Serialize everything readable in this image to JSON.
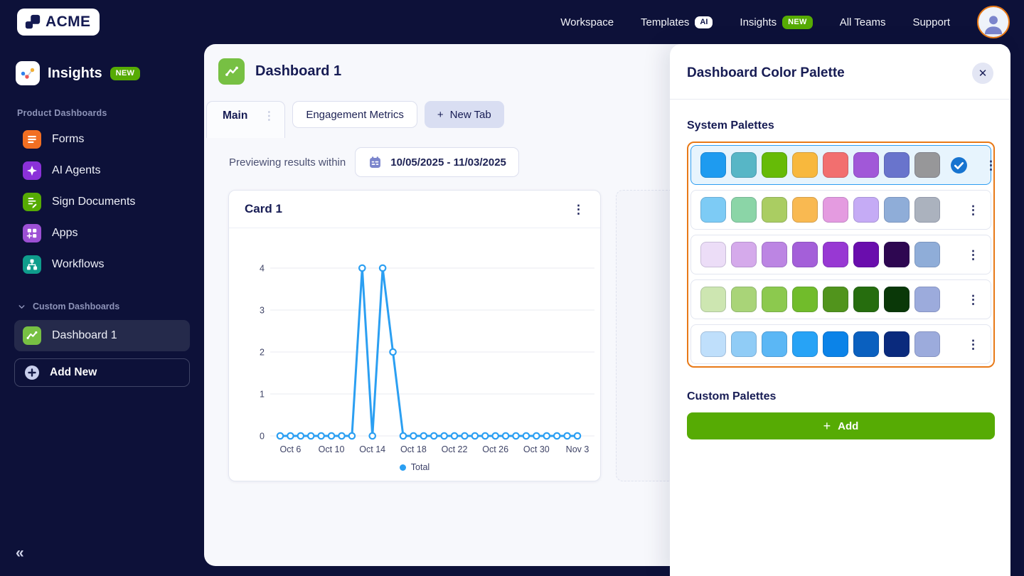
{
  "topnav": {
    "logo": "ACME",
    "items": [
      {
        "label": "Workspace"
      },
      {
        "label": "Templates",
        "badge": "AI",
        "badge_style": "ai"
      },
      {
        "label": "Insights",
        "badge": "NEW",
        "badge_style": "new"
      },
      {
        "label": "All Teams"
      },
      {
        "label": "Support"
      }
    ]
  },
  "sidebar": {
    "app": {
      "title": "Insights",
      "badge": "NEW"
    },
    "product_section_label": "Product Dashboards",
    "product_items": [
      {
        "label": "Forms",
        "icon": "forms-icon",
        "icon_color": "#f26f22"
      },
      {
        "label": "AI Agents",
        "icon": "ai-agents-icon",
        "icon_color": "#8b31d9"
      },
      {
        "label": "Sign Documents",
        "icon": "sign-documents-icon",
        "icon_color": "#56ab04"
      },
      {
        "label": "Apps",
        "icon": "apps-icon",
        "icon_color": "#9c50d4"
      },
      {
        "label": "Workflows",
        "icon": "workflows-icon",
        "icon_color": "#0f9d8c"
      }
    ],
    "custom_section_label": "Custom Dashboards",
    "custom_items": [
      {
        "label": "Dashboard 1",
        "icon": "dashboard-icon",
        "icon_color": "#77c043",
        "active": true
      }
    ],
    "add_new": "Add New",
    "collapse": "«"
  },
  "main": {
    "title": "Dashboard 1",
    "tabs": [
      {
        "label": "Main",
        "active": true
      },
      {
        "label": "Engagement Metrics",
        "active": false
      }
    ],
    "new_tab": "New Tab",
    "preview_label": "Previewing results within",
    "date_range": "10/05/2025 - 11/03/2025",
    "card_title": "Card 1"
  },
  "chart_data": {
    "type": "line",
    "title": "Card 1",
    "x": [
      "Oct 5",
      "Oct 6",
      "Oct 7",
      "Oct 8",
      "Oct 9",
      "Oct 10",
      "Oct 11",
      "Oct 12",
      "Oct 13",
      "Oct 14",
      "Oct 15",
      "Oct 16",
      "Oct 17",
      "Oct 18",
      "Oct 19",
      "Oct 20",
      "Oct 21",
      "Oct 22",
      "Oct 23",
      "Oct 24",
      "Oct 25",
      "Oct 26",
      "Oct 27",
      "Oct 28",
      "Oct 29",
      "Oct 30",
      "Oct 31",
      "Nov 1",
      "Nov 2",
      "Nov 3"
    ],
    "x_tick_labels": [
      "Oct 6",
      "Oct 10",
      "Oct 14",
      "Oct 18",
      "Oct 22",
      "Oct 26",
      "Oct 30",
      "Nov 3"
    ],
    "series": [
      {
        "name": "Total",
        "color": "#2b9ff2",
        "values": [
          0,
          0,
          0,
          0,
          0,
          0,
          0,
          0,
          4,
          0,
          4,
          2,
          0,
          0,
          0,
          0,
          0,
          0,
          0,
          0,
          0,
          0,
          0,
          0,
          0,
          0,
          0,
          0,
          0,
          0
        ]
      }
    ],
    "ylim": [
      0,
      4
    ],
    "yticks": [
      0,
      1,
      2,
      3,
      4
    ],
    "grid": true,
    "legend_position": "bottom"
  },
  "panel": {
    "title": "Dashboard Color Palette",
    "system_heading": "System Palettes",
    "custom_heading": "Custom Palettes",
    "add_button": "Add",
    "accent_border": "#e87917",
    "selected_bg": "#e7f4fd",
    "selected_border": "#2e9df1",
    "add_button_color": "#56ab04",
    "system_palettes": [
      {
        "selected": true,
        "colors": [
          "#1e9bf0",
          "#57b6c6",
          "#66bb07",
          "#f8b83d",
          "#f26f6f",
          "#a158d8",
          "#6974cc",
          "#979799"
        ]
      },
      {
        "selected": false,
        "colors": [
          "#7dcbf5",
          "#8bd5a7",
          "#aacd62",
          "#f9b951",
          "#e49be0",
          "#c5abf5",
          "#8fadd8",
          "#abb2be"
        ]
      },
      {
        "selected": false,
        "colors": [
          "#ecddf7",
          "#d5aaeb",
          "#bc85e3",
          "#a45fd9",
          "#9838d3",
          "#6a0dad",
          "#2e0751",
          "#8fadd8"
        ]
      },
      {
        "selected": false,
        "colors": [
          "#cde6b1",
          "#a9d478",
          "#8cc94e",
          "#71bc2b",
          "#51941c",
          "#266d0e",
          "#0a3808",
          "#9cabdc"
        ]
      },
      {
        "selected": false,
        "colors": [
          "#bfdffb",
          "#90ccf6",
          "#5bb7f5",
          "#27a3f6",
          "#0b83e8",
          "#0a60bf",
          "#0a2a7d",
          "#9cabdc"
        ]
      }
    ]
  },
  "colors": {
    "background_navy": "#0d1139",
    "content_bg": "#f7f8fc",
    "text_navy": "#171c54",
    "chart_blue": "#2b9ff2",
    "accent_orange": "#e87917",
    "brand_green": "#56ab04",
    "periwinkle": "#7b85cc"
  }
}
